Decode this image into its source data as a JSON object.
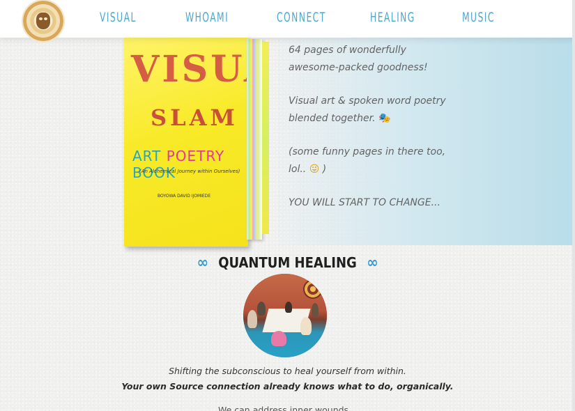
{
  "nav": {
    "items": [
      {
        "label": "VISUAL"
      },
      {
        "label": "WHOAMI"
      },
      {
        "label": "CONNECT"
      },
      {
        "label": "HEALING"
      },
      {
        "label": "MUSIC"
      }
    ]
  },
  "book": {
    "cover_title_1": "VISUAL",
    "cover_title_2": "SLAM",
    "cover_subtitle_a": "ART",
    "cover_subtitle_b": "POETRY",
    "cover_subtitle_c": "BOOK",
    "cover_tagline": "(An Alchemical Journey within Ourselves)",
    "cover_author": "BOYOWA DAVID IJOMIEDE"
  },
  "promo": {
    "line1": "64 pages of wonderfully awesome-packed goodness!",
    "line2": "Visual art & spoken word poetry blended together.",
    "line2_emoji": "🎭",
    "line3": "(some funny pages in there too, lol..",
    "line3_emoji": "😜",
    "line3_end": ")",
    "line4": "YOU WILL START TO CHANGE..."
  },
  "healing": {
    "title": "QUANTUM HEALING",
    "infinity": "∞",
    "caption1": "Shifting the subconscious to heal yourself from within.",
    "caption2": "Your own Source connection already knows what to do, organically.",
    "caption3": "We can address inner wounds..."
  },
  "colors": {
    "nav_accent": "#4ea7cf",
    "infinity_blue": "#2e9fd6",
    "book_yellow": "#f8ea28"
  }
}
